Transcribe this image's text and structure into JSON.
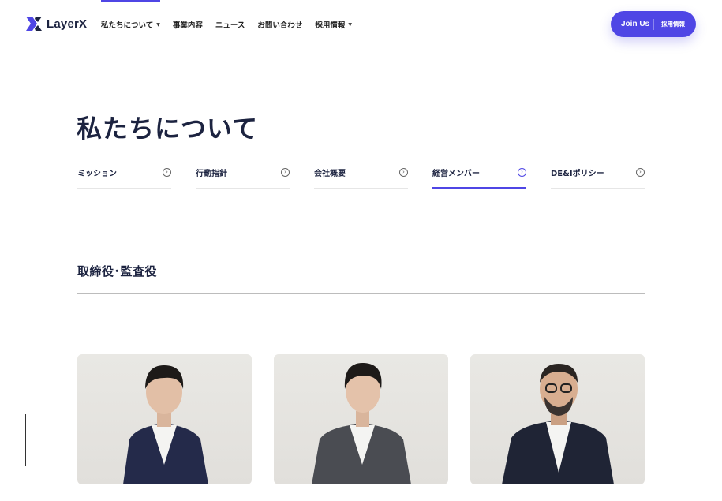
{
  "header": {
    "logo_text": "LayerX",
    "nav": [
      {
        "label": "私たちについて",
        "has_caret": true
      },
      {
        "label": "事業内容",
        "has_caret": false
      },
      {
        "label": "ニュース",
        "has_caret": false
      },
      {
        "label": "お問い合わせ",
        "has_caret": false
      },
      {
        "label": "採用情報",
        "has_caret": true
      }
    ],
    "join": {
      "main": "Join Us",
      "sub": "採用情報"
    }
  },
  "page": {
    "title": "私たちについて"
  },
  "tabs": [
    {
      "label": "ミッション",
      "active": false
    },
    {
      "label": "行動指針",
      "active": false
    },
    {
      "label": "会社概要",
      "active": false
    },
    {
      "label": "経営メンバー",
      "active": true
    },
    {
      "label": "DE&Iポリシー",
      "active": false
    }
  ],
  "section": {
    "title": "取締役･監査役"
  },
  "colors": {
    "accent": "#4f46e5",
    "text_dark": "#1c2340"
  },
  "icons": {
    "tab": "circle-arrow-icon",
    "caret": "caret-down-icon"
  }
}
